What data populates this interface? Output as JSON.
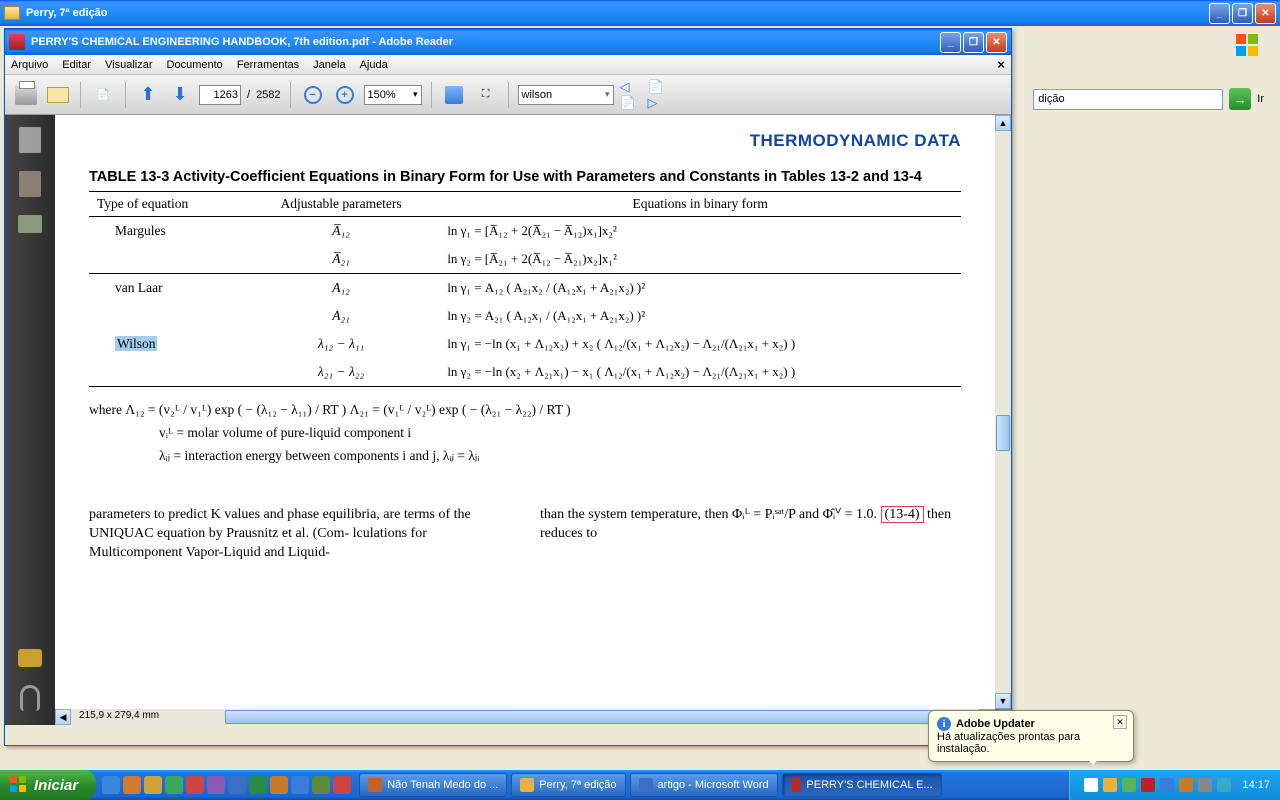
{
  "explorer": {
    "title": "Perry, 7ª edição",
    "address": "dição",
    "go": "Ir"
  },
  "reader": {
    "title": "PERRY'S CHEMICAL ENGINEERING HANDBOOK, 7th edition.pdf - Adobe Reader",
    "menu": [
      "Arquivo",
      "Editar",
      "Visualizar",
      "Documento",
      "Ferramentas",
      "Janela",
      "Ajuda"
    ],
    "page_current": "1263",
    "page_sep": "/",
    "page_total": "2582",
    "zoom": "150%",
    "search": "wilson",
    "statusbar": "215,9 x 279,4 mm"
  },
  "doc": {
    "header": "THERMODYNAMIC DATA",
    "table_title": "TABLE 13-3   Activity-Coefficient Equations in Binary Form for Use with Parameters and Constants in Tables 13-2 and 13-4",
    "cols": [
      "Type of equation",
      "Adjustable parameters",
      "Equations in binary form"
    ],
    "rows": [
      {
        "name": "Margules",
        "p1": "A̅₁₂",
        "e1": "ln γ₁ = [A̅₁₂ + 2(A̅₂₁ − A̅₁₂)x₁]x₂²",
        "p2": "A̅₂₁",
        "e2": "ln γ₂ = [A̅₂₁ + 2(A̅₁₂ − A̅₂₁)x₂]x₁²"
      },
      {
        "name": "van Laar",
        "p1": "A₁₂",
        "e1": "ln γ₁ = A₁₂ ( A₂₁x₂ / (A₁₂x₁ + A₂₁x₂) )²",
        "p2": "A₂₁",
        "e2": "ln γ₂ = A₂₁ ( A₁₂x₁ / (A₁₂x₁ + A₂₁x₂) )²"
      },
      {
        "name": "Wilson",
        "p1": "λ₁₂ − λ₁₁",
        "e1": "ln γ₁ = −ln (x₁ + Λ₁₂x₂) + x₂ ( Λ₁₂/(x₁ + Λ₁₂x₂) − Λ₂₁/(Λ₂₁x₁ + x₂) )",
        "p2": "λ₂₁ − λ₂₂",
        "e2": "ln γ₂ = −ln (x₂ + Λ₂₁x₁) − x₁ ( Λ₁₂/(x₁ + Λ₁₂x₂) − Λ₂₁/(Λ₂₁x₁ + x₂) )"
      }
    ],
    "where1": "where   Λ₁₂ = (v₂ᴸ / v₁ᴸ) exp ( − (λ₁₂ − λ₁₁) / RT )   Λ₂₁ = (v₁ᴸ / v₂ᴸ) exp ( − (λ₂₁ − λ₂₂) / RT )",
    "where2": "vᵢᴸ = molar volume of pure-liquid component i",
    "where3": "λᵢⱼ = interaction energy between components i and j, λᵢⱼ = λⱼᵢ",
    "col_left": "parameters to predict K values and phase equilibria, are terms of the UNIQUAC equation by Prausnitz et al. (Com-  lculations for Multicomponent Vapor-Liquid and Liquid-",
    "col_right_a": "than the system temperature, then Φᵢᴸ = Pᵢˢᵃᵗ/P and Φ̂ᵢⱽ = 1.0. ",
    "eqref": "(13-4)",
    "col_right_b": " then reduces to"
  },
  "balloon": {
    "title": "Adobe Updater",
    "msg": "Há atualizações prontas para instalação."
  },
  "taskbar": {
    "start": "Iniciar",
    "tasks": [
      {
        "label": "Não Tenah Medo do ...",
        "color": "#c0632e"
      },
      {
        "label": "Perry, 7ª edição",
        "color": "#e7b23e"
      },
      {
        "label": "artigo - Microsoft Word",
        "color": "#3a6fc4"
      },
      {
        "label": "PERRY'S CHEMICAL E...",
        "color": "#b22a2a",
        "active": true
      }
    ],
    "clock": "14:17"
  }
}
